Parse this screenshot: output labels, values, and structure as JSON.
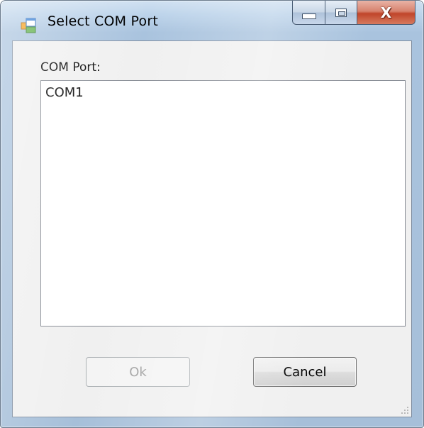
{
  "window": {
    "title": "Select COM Port",
    "app_icon": "window-app-icon",
    "caption_buttons": {
      "minimize": "minimize-icon",
      "maximize": "maximize-icon",
      "close": "close-icon",
      "close_glyph": "X"
    }
  },
  "form": {
    "com_port_label": "COM Port:",
    "com_ports": [
      "COM1"
    ]
  },
  "buttons": {
    "ok_label": "Ok",
    "ok_enabled": false,
    "cancel_label": "Cancel"
  },
  "colors": {
    "client_background": "#f0f0f0",
    "close_button_red": "#c0452a",
    "disabled_text": "#a0a0a0"
  }
}
